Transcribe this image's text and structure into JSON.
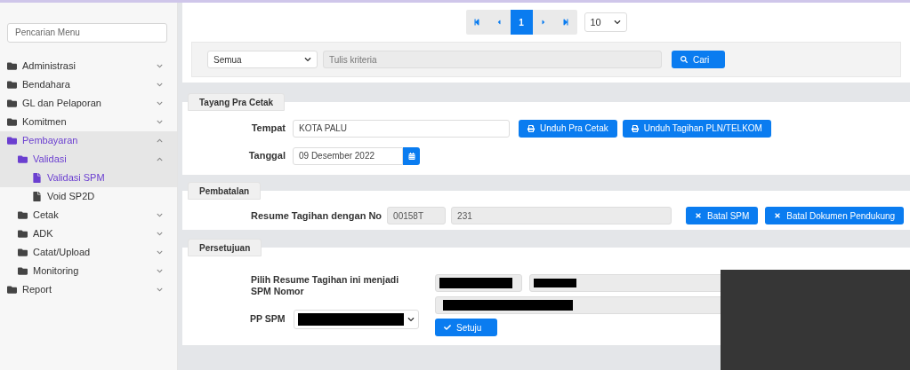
{
  "sidebar": {
    "search": {
      "placeholder": "Pencarian Menu"
    },
    "items": [
      {
        "label": "Administrasi",
        "kind": "folder",
        "expanded": false,
        "selected": false
      },
      {
        "label": "Bendahara",
        "kind": "folder",
        "expanded": false,
        "selected": false
      },
      {
        "label": "GL dan Pelaporan",
        "kind": "folder",
        "expanded": false,
        "selected": false
      },
      {
        "label": "Komitmen",
        "kind": "folder",
        "expanded": false,
        "selected": false
      },
      {
        "label": "Pembayaran",
        "kind": "folder",
        "expanded": true,
        "selected": true,
        "children": [
          {
            "label": "Validasi",
            "kind": "folder",
            "expanded": true,
            "selected": true,
            "children": [
              {
                "label": "Validasi SPM",
                "kind": "page",
                "selected": true
              },
              {
                "label": "Void SP2D",
                "kind": "page",
                "selected": false
              }
            ]
          },
          {
            "label": "Cetak",
            "kind": "folder",
            "expanded": false,
            "selected": false
          },
          {
            "label": "ADK",
            "kind": "folder",
            "expanded": false,
            "selected": false
          },
          {
            "label": "Catat/Upload",
            "kind": "folder",
            "expanded": false,
            "selected": false
          },
          {
            "label": "Monitoring",
            "kind": "folder",
            "expanded": false,
            "selected": false
          }
        ]
      },
      {
        "label": "Report",
        "kind": "folder",
        "expanded": false,
        "selected": false
      }
    ]
  },
  "pagination": {
    "buttons": [
      {
        "kind": "first",
        "selected": false
      },
      {
        "kind": "prev",
        "selected": false
      },
      {
        "kind": "page",
        "label": "1",
        "selected": true
      },
      {
        "kind": "next",
        "selected": false
      },
      {
        "kind": "last",
        "selected": false
      }
    ],
    "page_size": "10"
  },
  "filter": {
    "field": "Semua",
    "placeholder": "Tulis kriteria",
    "button": "Cari"
  },
  "tayang": {
    "title": "Tayang Pra Cetak",
    "tempat_label": "Tempat",
    "tempat": "KOTA PALU",
    "buttons": [
      "Unduh Pra Cetak",
      "Unduh Tagihan PLN/TELKOM"
    ],
    "tanggal_label": "Tanggal",
    "tanggal": "09 Desember 2022"
  },
  "pembatalan": {
    "title": "Pembatalan",
    "label": "Resume Tagihan dengan No",
    "values": [
      "00158T",
      "231"
    ],
    "buttons": [
      "Batal SPM",
      "Batal Dokumen Pendukung"
    ]
  },
  "persetujuan": {
    "title": "Persetujuan",
    "label": "Pilih Resume Tagihan ini menjadi SPM Nomor",
    "pp_label": "PP SPM",
    "button": "Setuju"
  }
}
